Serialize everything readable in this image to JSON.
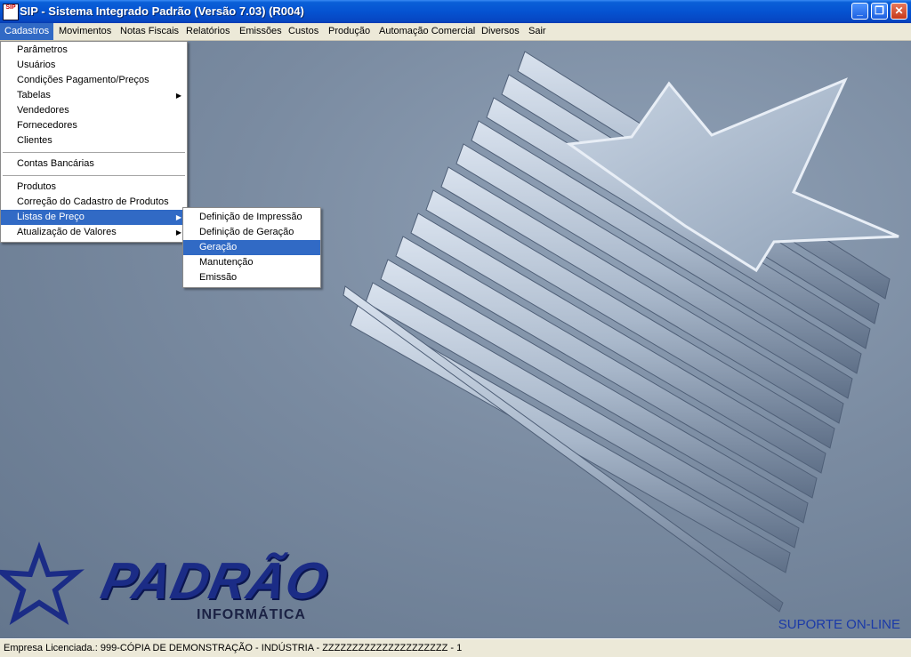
{
  "window": {
    "title": "SIP - Sistema Integrado Padrão  (Versão  7.03) (R004)",
    "icon_text": "SIP",
    "buttons": {
      "minimize": "_",
      "maximize": "❐",
      "close": "✕"
    }
  },
  "menubar": {
    "items": [
      "Cadastros",
      "Movimentos",
      "Notas Fiscais",
      "Relatórios",
      "Emissões",
      "Custos",
      "Produção",
      "Automação Comercial",
      "Diversos",
      "Sair"
    ],
    "active": "Cadastros"
  },
  "cadastros_menu": {
    "group1": [
      "Parâmetros",
      "Usuários",
      "Condições Pagamento/Preços",
      "Tabelas",
      "Vendedores",
      "Fornecedores",
      "Clientes"
    ],
    "group2": [
      "Contas Bancárias"
    ],
    "group3": [
      "Produtos",
      "Correção do Cadastro de Produtos",
      "Listas de Preço",
      "Atualização de Valores"
    ],
    "submenu_arrow": "▶"
  },
  "listas_submenu": {
    "items": [
      "Definição de Impressão",
      "Definição de Geração",
      "Geração",
      "Manutenção",
      "Emissão"
    ],
    "highlighted": "Geração"
  },
  "logo": {
    "name": "PADRÃO",
    "subtitle": "INFORMÁTICA"
  },
  "support_link": "SUPORTE ON-LINE",
  "status_bar": "Empresa Licenciada.: 999-CÓPIA DE DEMONSTRAÇÃO - INDÚSTRIA - ZZZZZZZZZZZZZZZZZZZZZ - 1",
  "colors": {
    "titlebar": "#0553d1",
    "menu_highlight": "#316ac5",
    "logo": "#1b2c86",
    "desktop": "#7a8ba1"
  }
}
